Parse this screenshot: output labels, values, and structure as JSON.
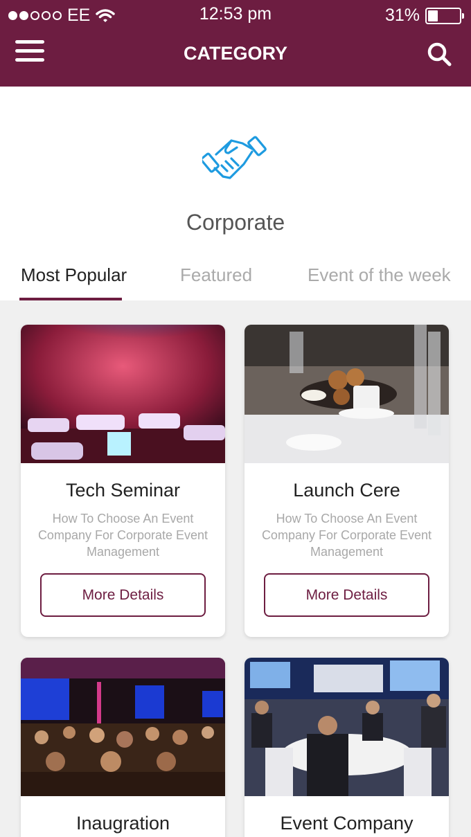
{
  "status_bar": {
    "carrier": "EE",
    "signal_bars_filled": 2,
    "signal_bars_total": 5,
    "time": "12:53 pm",
    "battery_percent": "31%",
    "battery_level": 0.31
  },
  "nav": {
    "title": "CATEGORY",
    "menu_icon": "hamburger-menu-icon",
    "search_icon": "search-icon"
  },
  "category": {
    "icon": "handshake-icon",
    "name": "Corporate"
  },
  "tabs": [
    {
      "label": "Most Popular",
      "active": true
    },
    {
      "label": "Featured",
      "active": false
    },
    {
      "label": "Event of the week",
      "active": false
    }
  ],
  "events": [
    {
      "title": "Tech Seminar",
      "description": "How To Choose An Event Company For Corporate Event Management",
      "button_label": "More Details",
      "image": "event-venue-lounge-photo"
    },
    {
      "title": "Launch Cere",
      "description": "How To Choose An Event Company For Corporate Event Management",
      "button_label": "More Details",
      "image": "dining-table-setting-photo"
    },
    {
      "title": "Inaugration",
      "image": "conference-audience-photo"
    },
    {
      "title": "Event Company",
      "image": "banquet-dinner-photo"
    }
  ],
  "colors": {
    "brand": "#6d1d41",
    "icon_blue": "#1e9be0",
    "background": "#f0f0f0"
  }
}
